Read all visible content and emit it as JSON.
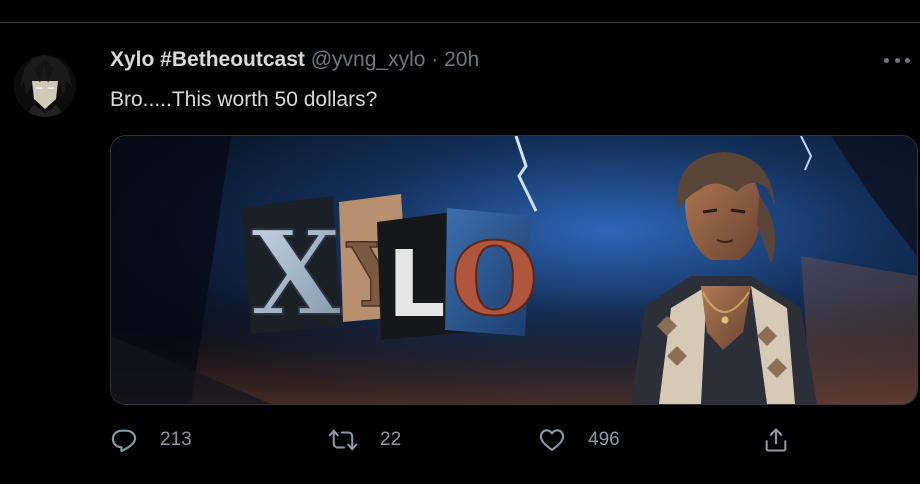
{
  "tweet": {
    "author_name": "Xylo #Betheoutcast",
    "handle": "@yvng_xylo",
    "separator": "·",
    "timestamp": "20h",
    "text": "Bro.....This worth 50 dollars?",
    "media": {
      "logo_letters": [
        "X",
        "Y",
        "L",
        "O"
      ]
    },
    "actions": {
      "reply_count": "213",
      "retweet_count": "22",
      "like_count": "496"
    }
  },
  "colors": {
    "background": "#000000",
    "primary_text": "#d9d9d9",
    "secondary_text": "#6e767d",
    "action_icon": "#8b98a5",
    "divider": "#2f3336"
  },
  "icons": [
    "more-icon",
    "reply-icon",
    "retweet-icon",
    "like-icon",
    "share-icon"
  ]
}
